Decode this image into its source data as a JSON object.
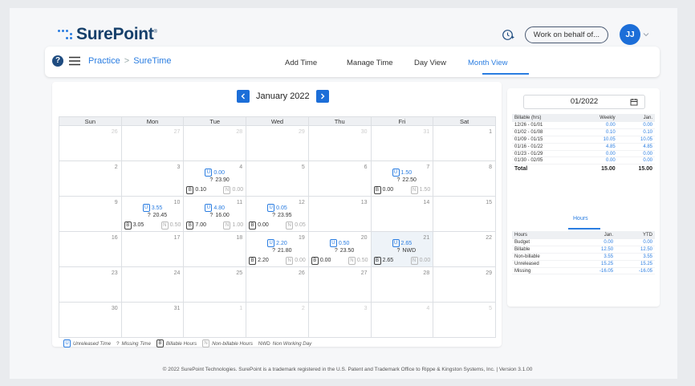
{
  "header": {
    "brand": "SurePoint",
    "trademark": "®",
    "work_on_behalf": "Work on behalf of...",
    "avatar_initials": "JJ"
  },
  "nav": {
    "breadcrumb_root": "Practice",
    "breadcrumb_separator": ">",
    "breadcrumb_current": "SureTime",
    "tabs": [
      {
        "label": "Add Time",
        "active": false
      },
      {
        "label": "Manage Time",
        "active": false
      },
      {
        "label": "Day View",
        "active": false
      },
      {
        "label": "Month View",
        "active": true
      }
    ]
  },
  "calendar": {
    "month_title": "January 2022",
    "weekdays": [
      "Sun",
      "Mon",
      "Tue",
      "Wed",
      "Thu",
      "Fri",
      "Sat"
    ],
    "weeks": [
      [
        {
          "d": "26",
          "out": true
        },
        {
          "d": "27",
          "out": true
        },
        {
          "d": "28",
          "out": true
        },
        {
          "d": "29",
          "out": true
        },
        {
          "d": "30",
          "out": true
        },
        {
          "d": "31",
          "out": true
        },
        {
          "d": "1"
        }
      ],
      [
        {
          "d": "2"
        },
        {
          "d": "3"
        },
        {
          "d": "4",
          "u": "0.00",
          "q": "23.90",
          "b": "0.10",
          "n": "0.00"
        },
        {
          "d": "5"
        },
        {
          "d": "6"
        },
        {
          "d": "7",
          "u": "1.50",
          "q": "22.50",
          "b": "0.00",
          "n": "1.50"
        },
        {
          "d": "8"
        }
      ],
      [
        {
          "d": "9"
        },
        {
          "d": "10",
          "u": "3.55",
          "q": "20.45",
          "b": "3.05",
          "n": "0.50"
        },
        {
          "d": "11",
          "u": "4.80",
          "q": "16.00",
          "b": "7.00",
          "n": "1.00"
        },
        {
          "d": "12",
          "u": "0.05",
          "q": "23.95",
          "b": "0.00",
          "n": "0.05"
        },
        {
          "d": "13"
        },
        {
          "d": "14"
        },
        {
          "d": "15"
        }
      ],
      [
        {
          "d": "16"
        },
        {
          "d": "17"
        },
        {
          "d": "18"
        },
        {
          "d": "19",
          "u": "2.20",
          "q": "21.80",
          "b": "2.20",
          "n": "0.00"
        },
        {
          "d": "20",
          "u": "0.50",
          "q": "23.50",
          "b": "0.00",
          "n": "0.50"
        },
        {
          "d": "21",
          "u": "2.65",
          "q": "NWD",
          "b": "2.65",
          "n": "0.00",
          "hl": true
        },
        {
          "d": "22"
        }
      ],
      [
        {
          "d": "23"
        },
        {
          "d": "24"
        },
        {
          "d": "25"
        },
        {
          "d": "26"
        },
        {
          "d": "27"
        },
        {
          "d": "28"
        },
        {
          "d": "29"
        }
      ],
      [
        {
          "d": "30"
        },
        {
          "d": "31"
        },
        {
          "d": "1",
          "out": true
        },
        {
          "d": "2",
          "out": true
        },
        {
          "d": "3",
          "out": true
        },
        {
          "d": "4",
          "out": true
        },
        {
          "d": "5",
          "out": true
        }
      ]
    ],
    "badge_u": "U",
    "badge_q": "?",
    "badge_b": "B",
    "badge_n": "N"
  },
  "legend": {
    "unreleased": "Unreleased Time",
    "missing": "Missing Time",
    "billable": "Billable Hours",
    "nonbillable": "Non-billable Hours",
    "nwd_code": "NWD",
    "nwd": "Non Working Day"
  },
  "sidebar": {
    "date_value": "01/2022",
    "weekly": {
      "headers": [
        "Billable (hrs)",
        "Weekly",
        "Jan."
      ],
      "rows": [
        [
          "12/26 - 01/01",
          "0.00",
          "0.00"
        ],
        [
          "01/02 - 01/08",
          "0.10",
          "0.10"
        ],
        [
          "01/09 - 01/15",
          "10.05",
          "10.05"
        ],
        [
          "01/16 - 01/22",
          "4.85",
          "4.85"
        ],
        [
          "01/23 - 01/29",
          "0.00",
          "0.00"
        ],
        [
          "01/30 - 02/05",
          "0.00",
          "0.00"
        ]
      ],
      "total": [
        "Total",
        "15.00",
        "15.00"
      ]
    },
    "hours_tab": "Hours",
    "hours": {
      "headers": [
        "Hours",
        "Jan.",
        "YTD"
      ],
      "rows": [
        [
          "Budget",
          "0.00",
          "0.00"
        ],
        [
          "Billable",
          "12.50",
          "12.50"
        ],
        [
          "Non-billable",
          "3.55",
          "3.55"
        ],
        [
          "Unreleased",
          "15.25",
          "15.25"
        ],
        [
          "Missing",
          "-16.05",
          "-16.05"
        ]
      ]
    }
  },
  "footer": "© 2022 SurePoint Technologies. SurePoint is a trademark registered in the U.S. Patent and Trademark Office to Rippe & Kingston Systems, Inc. | Version 3.1.00",
  "colors": {
    "accent": "#2a7de1",
    "brand_navy": "#16406b",
    "avatar": "#1c6ed8"
  }
}
